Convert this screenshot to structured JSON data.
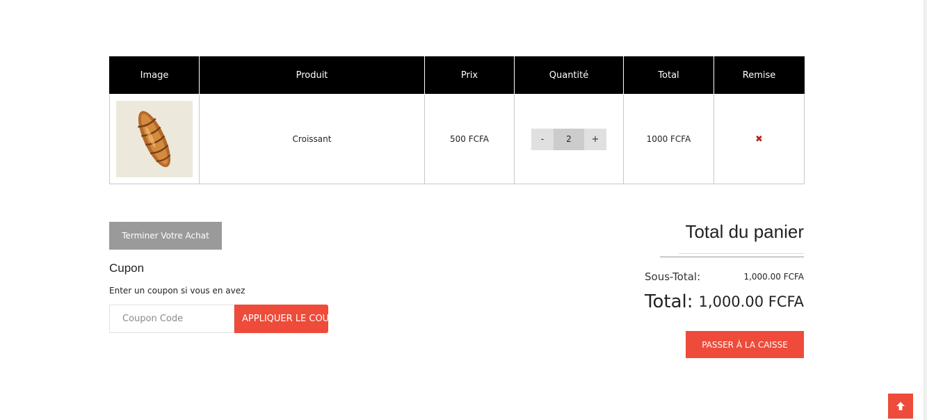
{
  "cart": {
    "headers": {
      "image": "Image",
      "product": "Produit",
      "price": "Prix",
      "quantity": "Quantité",
      "total": "Total",
      "remove": "Remise"
    },
    "items": [
      {
        "image_icon": "croissant-image",
        "name": "Croissant",
        "price": "500 FCFA",
        "qty_minus": "-",
        "quantity": "2",
        "qty_plus": "+",
        "total": "1000 FCFA",
        "remove_icon": "✖"
      }
    ]
  },
  "actions": {
    "finish_label": "Terminer Votre Achat"
  },
  "coupon": {
    "title": "Cupon",
    "hint": "Enter un coupon si vous en avez",
    "placeholder": "Coupon Code",
    "apply_label": "APPLIQUER LE COUPON"
  },
  "totals": {
    "title": "Total du panier",
    "subtotal_label": "Sous-Total:",
    "subtotal_value": "1,000.00 FCFA",
    "total_label": "Total:",
    "total_value": "1,000.00 FCFA",
    "checkout_label": "PASSER À LA CAISSE"
  },
  "colors": {
    "accent": "#ee4b3a",
    "header_bg": "#000000",
    "finish_button": "#9a9a9a",
    "remove_icon": "#b52424"
  },
  "icons": {
    "scroll_top": "arrow-up-icon"
  }
}
